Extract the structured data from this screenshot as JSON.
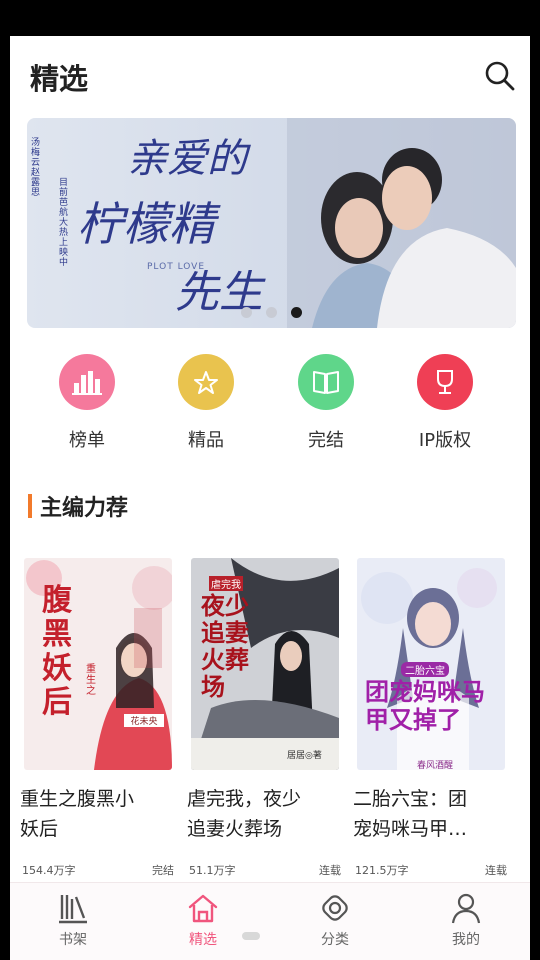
{
  "header": {
    "title": "精选"
  },
  "banner": {
    "title_line1": "亲爱的",
    "title_line2": "柠檬精",
    "title_line3": "先生",
    "subtitle": "PLOT LOVE",
    "side_text_1": "汤梅 云 赵 露思",
    "side_text_2": "目前 芭 航 大 热 上 映 中",
    "colors": {
      "bg": "#d9e0ec",
      "accent": "#2e3a8c"
    },
    "slides": [
      {
        "active": false
      },
      {
        "active": false
      },
      {
        "active": true
      }
    ]
  },
  "quick_links": [
    {
      "label": "榜单",
      "icon": "chart-icon",
      "color": "#f5799c"
    },
    {
      "label": "精品",
      "icon": "star-badge-icon",
      "color": "#e9c34e"
    },
    {
      "label": "完结",
      "icon": "book-icon",
      "color": "#5fd68a"
    },
    {
      "label": "IP版权",
      "icon": "trophy-icon",
      "color": "#ef3f55"
    }
  ],
  "section": {
    "title": "主编力荐"
  },
  "books": [
    {
      "title_line1": "重生之腹黑小",
      "title_line2": "妖后",
      "words": "154.4万字",
      "status": "完结",
      "cover_title": "腹黑妖后",
      "cover_sub": "重生之",
      "cover_author": "花未央"
    },
    {
      "title_line1": "虐完我，夜少",
      "title_line2": "追妻火葬场",
      "words": "51.1万字",
      "status": "连载",
      "cover_title": "夜少追妻火葬场",
      "cover_sub": "虐完我",
      "cover_author": "居居◎著"
    },
    {
      "title_line1": "二胎六宝：团",
      "title_line2": "宠妈咪马甲…",
      "words": "121.5万字",
      "status": "连载",
      "cover_title": "团宠妈咪马甲又掉了",
      "cover_sub": "二胎六宝",
      "cover_author": "春风酒醒"
    }
  ],
  "tabs": [
    {
      "label": "书架",
      "icon": "bookshelf-icon",
      "active": false
    },
    {
      "label": "精选",
      "icon": "home-icon",
      "active": true
    },
    {
      "label": "分类",
      "icon": "category-icon",
      "active": false
    },
    {
      "label": "我的",
      "icon": "user-icon",
      "active": false
    }
  ]
}
